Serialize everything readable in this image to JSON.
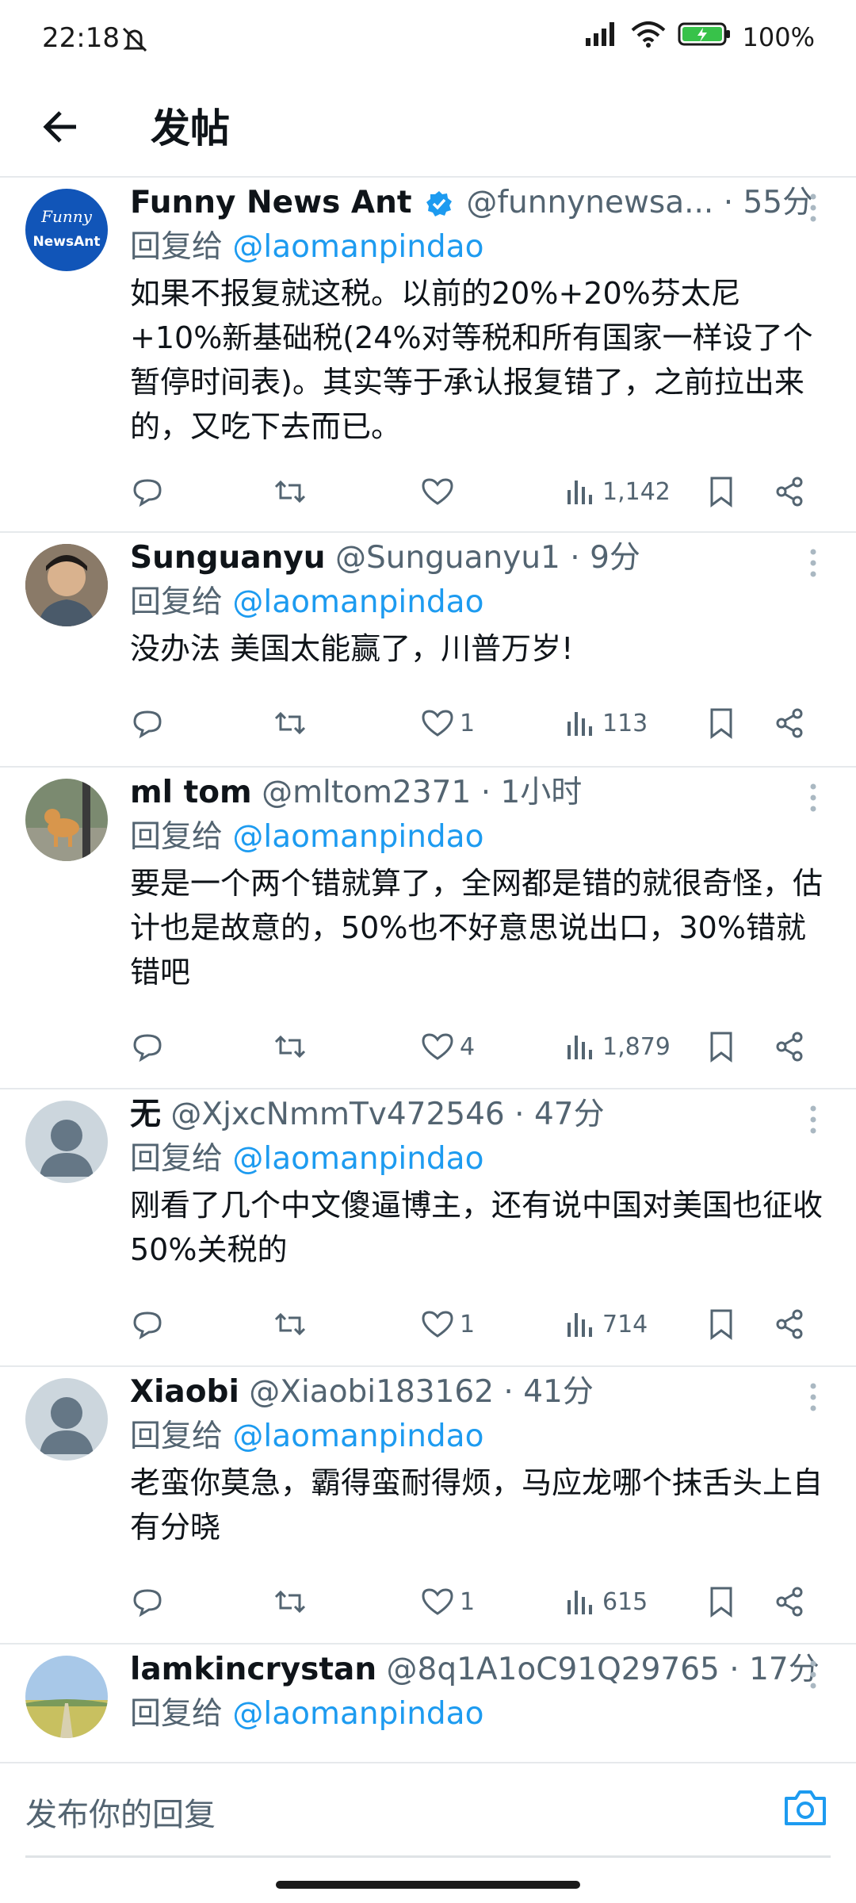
{
  "status": {
    "time": "22:18",
    "battery": "100%"
  },
  "appbar": {
    "title": "发帖"
  },
  "posts": [
    {
      "name": "Funny News Ant",
      "verified": true,
      "handle": "@funnynewsa...",
      "time": " · 55分",
      "reply_prefix": "回复给 ",
      "reply_to": "@laomanpindao",
      "text": "如果不报复就这税。以前的20%+20%芬太尼+10%新基础税(24%对等税和所有国家一样设了个暂停时间表)。其实等于承认报复错了，之前拉出来的，又吃下去而已。",
      "likes": "",
      "views": "1,142",
      "avatar_text": [
        "Funny",
        "NewsAnt"
      ]
    },
    {
      "name": "Sunguanyu",
      "verified": false,
      "handle": " @Sunguanyu1",
      "time": " · 9分",
      "reply_prefix": "回复给 ",
      "reply_to": "@laomanpindao",
      "text": "没办法 美国太能赢了，川普万岁!",
      "likes": "1",
      "views": "113"
    },
    {
      "name": "ml tom",
      "verified": false,
      "handle": " @mltom2371",
      "time": " · 1小时",
      "reply_prefix": "回复给 ",
      "reply_to": "@laomanpindao",
      "text": "要是一个两个错就算了，全网都是错的就很奇怪，估计也是故意的，50%也不好意思说出口，30%错就错吧",
      "likes": "4",
      "views": "1,879"
    },
    {
      "name": "无",
      "verified": false,
      "handle": " @XjxcNmmTv472546",
      "time": " · 47分",
      "reply_prefix": "回复给 ",
      "reply_to": "@laomanpindao",
      "text": "刚看了几个中文傻逼博主，还有说中国对美国也征收50%关税的",
      "likes": "1",
      "views": "714"
    },
    {
      "name": "Xiaobi",
      "verified": false,
      "handle": " @Xiaobi183162",
      "time": " · 41分",
      "reply_prefix": "回复给 ",
      "reply_to": "@laomanpindao",
      "text": "老蛮你莫急，霸得蛮耐得烦，马应龙哪个抹舌头上自有分晓",
      "likes": "1",
      "views": "615"
    },
    {
      "name": "lamkincrystan",
      "verified": false,
      "handle": " @8q1A1oC91Q29765",
      "time": " · 17分",
      "reply_prefix": "回复给 ",
      "reply_to": "@laomanpindao",
      "text": "",
      "likes": "",
      "views": ""
    }
  ],
  "composer": {
    "placeholder": "发布你的回复"
  }
}
